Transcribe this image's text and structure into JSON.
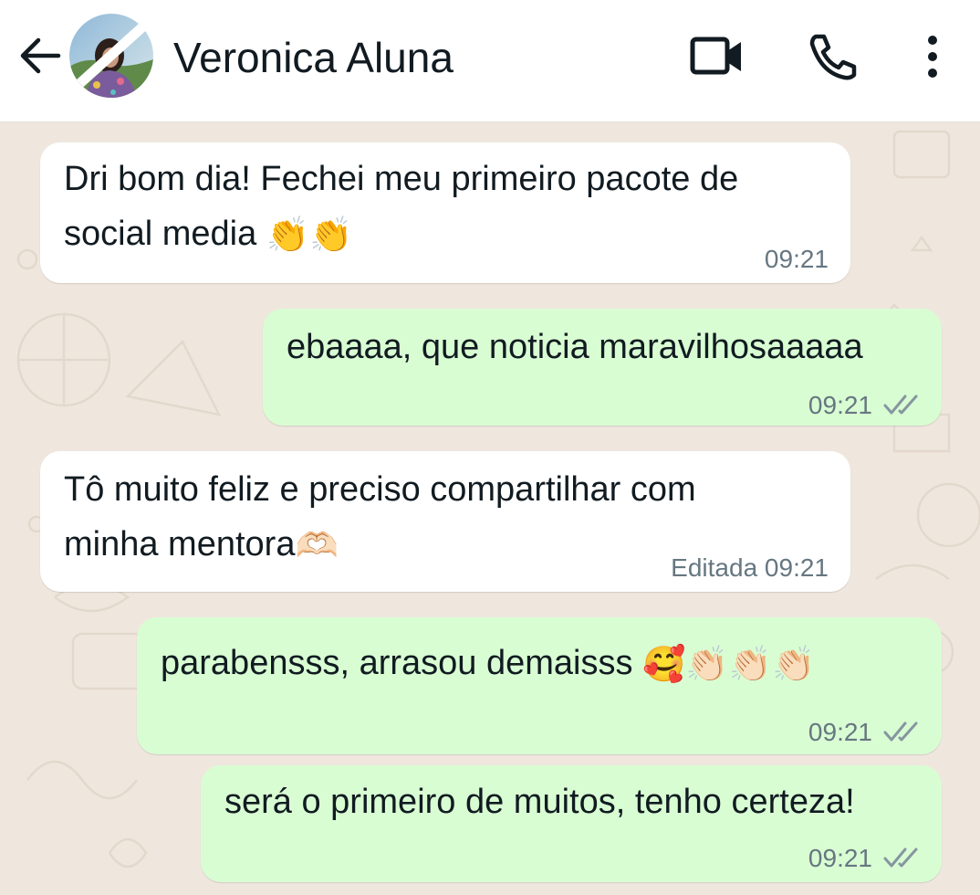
{
  "header": {
    "contact_name": "Veronica Aluna",
    "back_icon": "arrow-left-icon",
    "video_icon": "video-camera-icon",
    "call_icon": "phone-icon",
    "menu_icon": "more-vert-icon"
  },
  "messages": [
    {
      "direction": "in",
      "text_line1": "Dri bom dia! Fechei meu primeiro pacote de",
      "text_line2": "social media",
      "emoji": "👏👏",
      "time": "09:21"
    },
    {
      "direction": "out",
      "text_line1": "ebaaaa, que noticia maravilhosaaaaa",
      "time": "09:21",
      "status_icon": "double-check-icon"
    },
    {
      "direction": "in",
      "text_line1": "Tô muito feliz e preciso compartilhar com",
      "text_line2": "minha mentora",
      "emoji": "🫶🏻",
      "edited_label": "Editada",
      "time": "09:21"
    },
    {
      "direction": "out",
      "text_line1": "parabensss, arrasou demaisss",
      "emoji": "🥰👏🏻👏🏻👏🏻",
      "time": "09:21",
      "status_icon": "double-check-icon"
    },
    {
      "direction": "out",
      "text_line1": "será o primeiro de muitos, tenho certeza!",
      "time": "09:21",
      "status_icon": "double-check-icon"
    }
  ],
  "colors": {
    "header_bg": "#ffffff",
    "chat_bg": "#efe7de",
    "incoming_bubble": "#ffffff",
    "outgoing_bubble": "#d9fdd3",
    "text": "#111b21",
    "meta_text": "#667781"
  }
}
